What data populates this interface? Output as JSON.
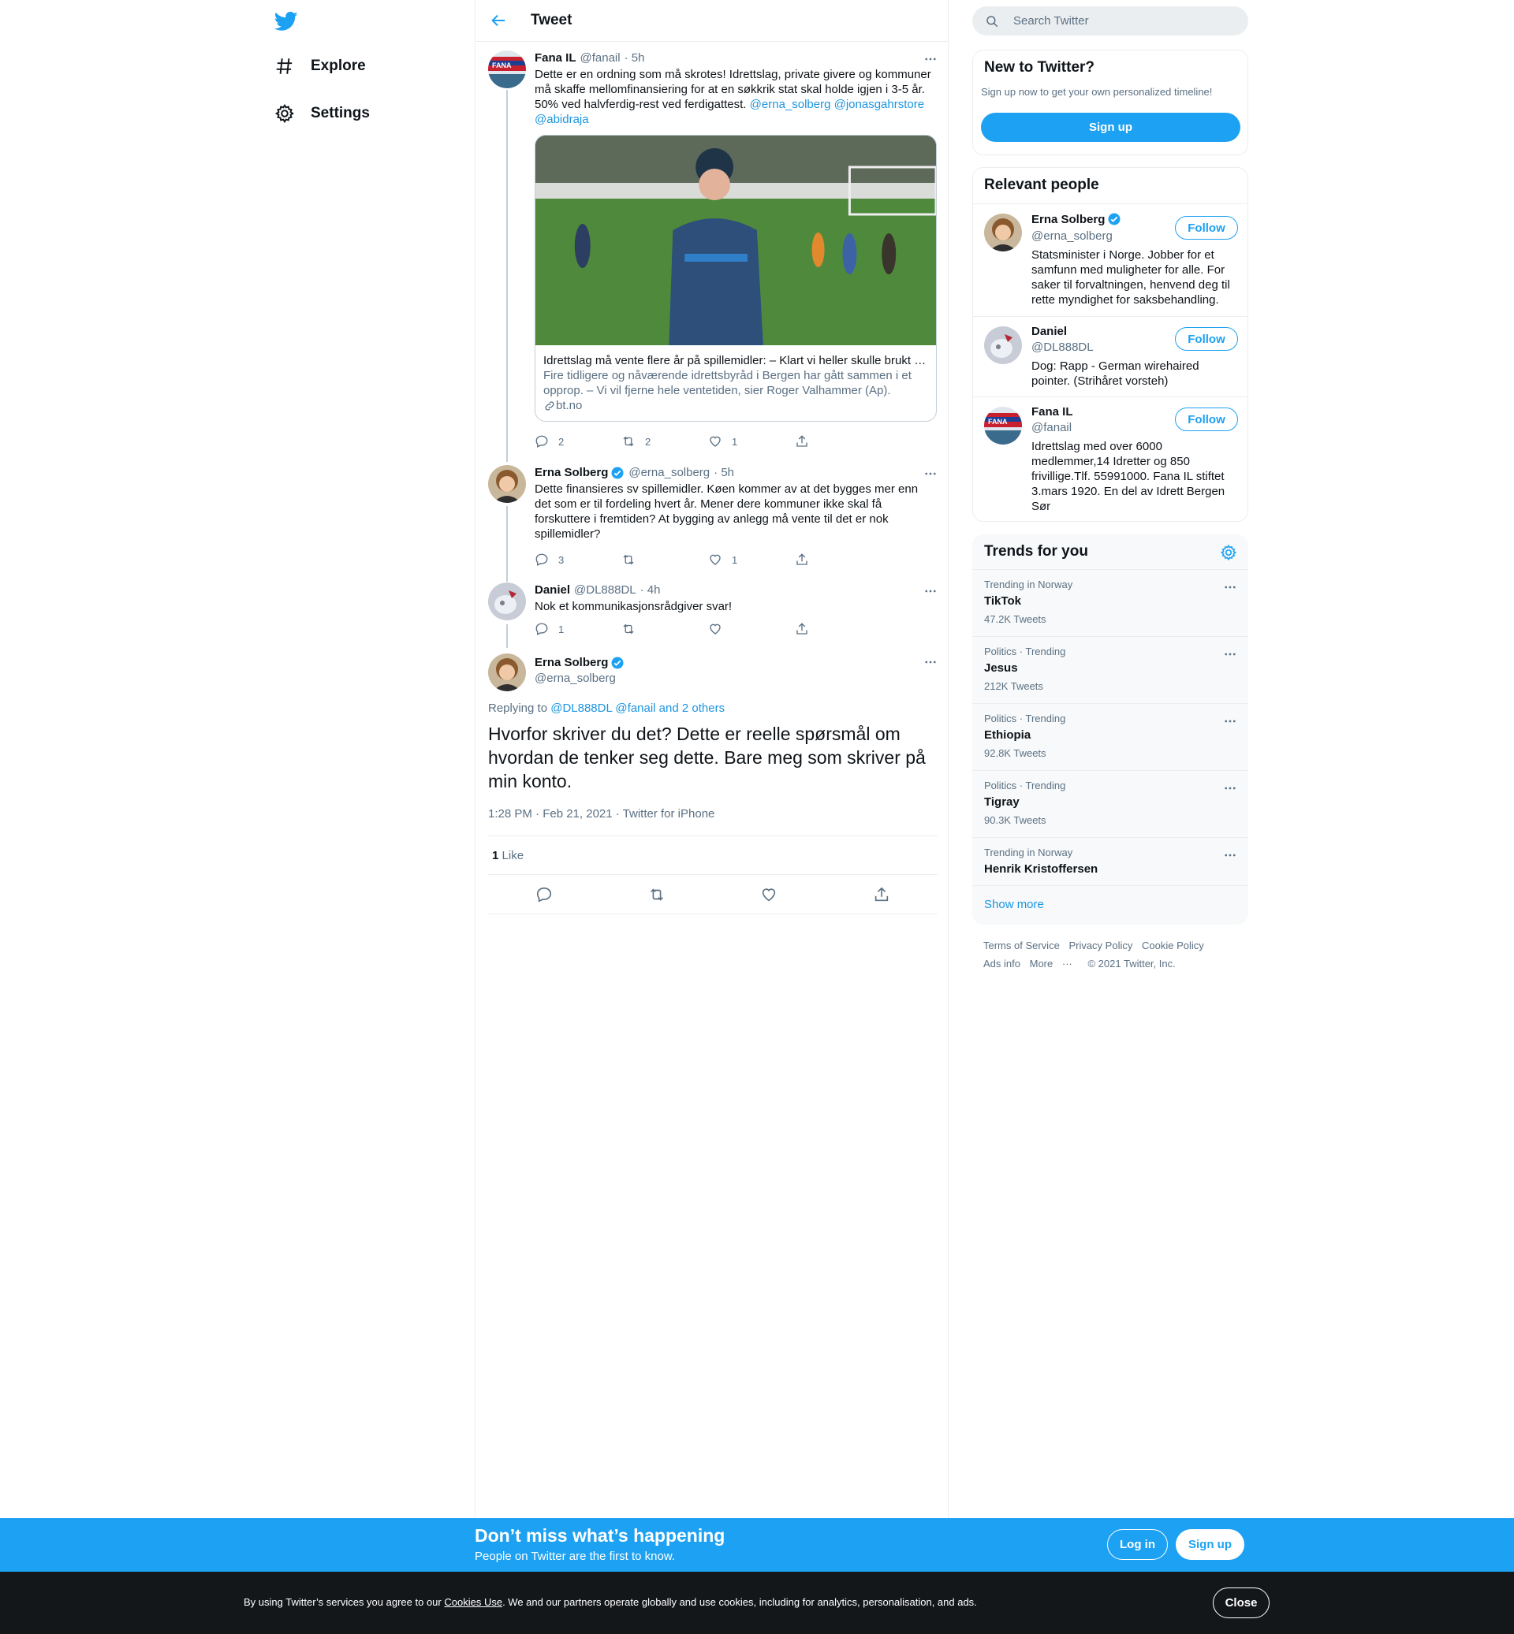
{
  "nav": {
    "items": [
      {
        "label": "Explore",
        "icon": "hashtag-icon"
      },
      {
        "label": "Settings",
        "icon": "gear-icon"
      }
    ]
  },
  "header": {
    "title": "Tweet"
  },
  "tweets": [
    {
      "name": "Fana IL",
      "handle": "@fanail",
      "time": "· 5h",
      "text": "Dette er en ordning som må skrotes! Idrettslag, private givere og kommuner må skaffe mellomfinansiering for at en søkkrik stat skal holde igjen i 3-5 år. 50% ved halvferdig-rest ved ferdigattest. ",
      "mentions": "@erna_solberg @jonasgahrstore @abidraja",
      "card": {
        "title": "Idrettslag må vente flere år på spillemidler: – Klart vi heller skulle brukt tiden på barn og unge",
        "description": "Fire tidligere og nåværende idrettsbyråd i Bergen har gått sammen i et opprop. – Vi vil fjerne hele ventetiden, sier Roger Valhammer (Ap).",
        "domain": "bt.no"
      },
      "replies": "2",
      "retweets": "2",
      "likes": "1"
    },
    {
      "name": "Erna Solberg",
      "handle": "@erna_solberg",
      "time": "· 5h",
      "text": "Dette finansieres sv spillemidler. Køen kommer av at det bygges mer enn det som er til fordeling hvert år. Mener dere kommuner ikke skal få forskuttere i fremtiden? At bygging av anlegg må vente til det er nok spillemidler?",
      "replies": "3",
      "retweets": "",
      "likes": "1"
    },
    {
      "name": "Daniel",
      "handle": "@DL888DL",
      "time": "· 4h",
      "text": "Nok et kommunikasjonsrådgiver svar!",
      "replies": "1",
      "retweets": "",
      "likes": ""
    }
  ],
  "main_tweet": {
    "name": "Erna Solberg",
    "handle": "@erna_solberg",
    "replying_prefix": "Replying to ",
    "replying_to": "@DL888DL @fanail and 2 others",
    "text": "Hvorfor skriver du det? Dette er reelle spørsmål om hvordan de tenker seg dette. Bare meg som skriver på min konto.",
    "timestamp": "1:28 PM · Feb 21, 2021 · Twitter for iPhone",
    "like_count": "1",
    "like_label": "Like"
  },
  "search": {
    "placeholder": "Search Twitter"
  },
  "new_to_twitter": {
    "title": "New to Twitter?",
    "subtitle": "Sign up now to get your own personalized timeline!",
    "button": "Sign up"
  },
  "relevant": {
    "title": "Relevant people",
    "follow_label": "Follow",
    "people": [
      {
        "name": "Erna Solberg",
        "handle": "@erna_solberg",
        "bio": "Statsminister i Norge. Jobber for et samfunn med muligheter for alle. For saker til forvaltningen, henvend deg til rette myndighet for saksbehandling."
      },
      {
        "name": "Daniel",
        "handle": "@DL888DL",
        "bio": "Dog: Rapp - German wirehaired pointer. (Strihåret vorsteh)"
      },
      {
        "name": "Fana IL",
        "handle": "@fanail",
        "bio": "Idrettslag med over 6000 medlemmer,14 Idretter og 850 frivillige.Tlf. 55991000. Fana IL stiftet 3.mars 1920. En del av Idrett Bergen Sør"
      }
    ]
  },
  "trends": {
    "title": "Trends for you",
    "items": [
      {
        "context": "Trending in Norway",
        "name": "TikTok",
        "count": "47.2K Tweets"
      },
      {
        "context": "Politics · Trending",
        "name": "Jesus",
        "count": "212K Tweets"
      },
      {
        "context": "Politics · Trending",
        "name": "Ethiopia",
        "count": "92.8K Tweets"
      },
      {
        "context": "Politics · Trending",
        "name": "Tigray",
        "count": "90.3K Tweets"
      },
      {
        "context": "Trending in Norway",
        "name": "Henrik Kristoffersen",
        "count": ""
      }
    ],
    "show_more": "Show more"
  },
  "footer": {
    "terms": "Terms of Service",
    "privacy": "Privacy Policy",
    "cookie": "Cookie Policy",
    "ads": "Ads info",
    "more": "More",
    "copyright": "© 2021 Twitter, Inc."
  },
  "bottom_bar": {
    "title": "Don’t miss what’s happening",
    "subtitle": "People on Twitter are the first to know.",
    "login": "Log in",
    "signup": "Sign up"
  },
  "cookie_bar": {
    "text_before": "By using Twitter’s services you agree to our ",
    "link": "Cookies Use",
    "text_after": ". We and our partners operate globally and use cookies, including for analytics, personalisation, and ads.",
    "close": "Close"
  },
  "colors": {
    "accent": "#1da1f2",
    "link": "#1b95e0",
    "cookie_bg": "#14171a"
  }
}
